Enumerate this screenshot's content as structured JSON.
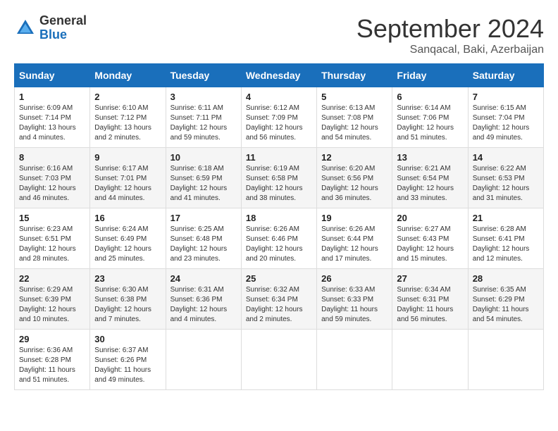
{
  "header": {
    "logo_general": "General",
    "logo_blue": "Blue",
    "month_title": "September 2024",
    "location": "Sanqacal, Baki, Azerbaijan"
  },
  "columns": [
    "Sunday",
    "Monday",
    "Tuesday",
    "Wednesday",
    "Thursday",
    "Friday",
    "Saturday"
  ],
  "weeks": [
    [
      {
        "day": "1",
        "sunrise": "Sunrise: 6:09 AM",
        "sunset": "Sunset: 7:14 PM",
        "daylight": "Daylight: 13 hours and 4 minutes."
      },
      {
        "day": "2",
        "sunrise": "Sunrise: 6:10 AM",
        "sunset": "Sunset: 7:12 PM",
        "daylight": "Daylight: 13 hours and 2 minutes."
      },
      {
        "day": "3",
        "sunrise": "Sunrise: 6:11 AM",
        "sunset": "Sunset: 7:11 PM",
        "daylight": "Daylight: 12 hours and 59 minutes."
      },
      {
        "day": "4",
        "sunrise": "Sunrise: 6:12 AM",
        "sunset": "Sunset: 7:09 PM",
        "daylight": "Daylight: 12 hours and 56 minutes."
      },
      {
        "day": "5",
        "sunrise": "Sunrise: 6:13 AM",
        "sunset": "Sunset: 7:08 PM",
        "daylight": "Daylight: 12 hours and 54 minutes."
      },
      {
        "day": "6",
        "sunrise": "Sunrise: 6:14 AM",
        "sunset": "Sunset: 7:06 PM",
        "daylight": "Daylight: 12 hours and 51 minutes."
      },
      {
        "day": "7",
        "sunrise": "Sunrise: 6:15 AM",
        "sunset": "Sunset: 7:04 PM",
        "daylight": "Daylight: 12 hours and 49 minutes."
      }
    ],
    [
      {
        "day": "8",
        "sunrise": "Sunrise: 6:16 AM",
        "sunset": "Sunset: 7:03 PM",
        "daylight": "Daylight: 12 hours and 46 minutes."
      },
      {
        "day": "9",
        "sunrise": "Sunrise: 6:17 AM",
        "sunset": "Sunset: 7:01 PM",
        "daylight": "Daylight: 12 hours and 44 minutes."
      },
      {
        "day": "10",
        "sunrise": "Sunrise: 6:18 AM",
        "sunset": "Sunset: 6:59 PM",
        "daylight": "Daylight: 12 hours and 41 minutes."
      },
      {
        "day": "11",
        "sunrise": "Sunrise: 6:19 AM",
        "sunset": "Sunset: 6:58 PM",
        "daylight": "Daylight: 12 hours and 38 minutes."
      },
      {
        "day": "12",
        "sunrise": "Sunrise: 6:20 AM",
        "sunset": "Sunset: 6:56 PM",
        "daylight": "Daylight: 12 hours and 36 minutes."
      },
      {
        "day": "13",
        "sunrise": "Sunrise: 6:21 AM",
        "sunset": "Sunset: 6:54 PM",
        "daylight": "Daylight: 12 hours and 33 minutes."
      },
      {
        "day": "14",
        "sunrise": "Sunrise: 6:22 AM",
        "sunset": "Sunset: 6:53 PM",
        "daylight": "Daylight: 12 hours and 31 minutes."
      }
    ],
    [
      {
        "day": "15",
        "sunrise": "Sunrise: 6:23 AM",
        "sunset": "Sunset: 6:51 PM",
        "daylight": "Daylight: 12 hours and 28 minutes."
      },
      {
        "day": "16",
        "sunrise": "Sunrise: 6:24 AM",
        "sunset": "Sunset: 6:49 PM",
        "daylight": "Daylight: 12 hours and 25 minutes."
      },
      {
        "day": "17",
        "sunrise": "Sunrise: 6:25 AM",
        "sunset": "Sunset: 6:48 PM",
        "daylight": "Daylight: 12 hours and 23 minutes."
      },
      {
        "day": "18",
        "sunrise": "Sunrise: 6:26 AM",
        "sunset": "Sunset: 6:46 PM",
        "daylight": "Daylight: 12 hours and 20 minutes."
      },
      {
        "day": "19",
        "sunrise": "Sunrise: 6:26 AM",
        "sunset": "Sunset: 6:44 PM",
        "daylight": "Daylight: 12 hours and 17 minutes."
      },
      {
        "day": "20",
        "sunrise": "Sunrise: 6:27 AM",
        "sunset": "Sunset: 6:43 PM",
        "daylight": "Daylight: 12 hours and 15 minutes."
      },
      {
        "day": "21",
        "sunrise": "Sunrise: 6:28 AM",
        "sunset": "Sunset: 6:41 PM",
        "daylight": "Daylight: 12 hours and 12 minutes."
      }
    ],
    [
      {
        "day": "22",
        "sunrise": "Sunrise: 6:29 AM",
        "sunset": "Sunset: 6:39 PM",
        "daylight": "Daylight: 12 hours and 10 minutes."
      },
      {
        "day": "23",
        "sunrise": "Sunrise: 6:30 AM",
        "sunset": "Sunset: 6:38 PM",
        "daylight": "Daylight: 12 hours and 7 minutes."
      },
      {
        "day": "24",
        "sunrise": "Sunrise: 6:31 AM",
        "sunset": "Sunset: 6:36 PM",
        "daylight": "Daylight: 12 hours and 4 minutes."
      },
      {
        "day": "25",
        "sunrise": "Sunrise: 6:32 AM",
        "sunset": "Sunset: 6:34 PM",
        "daylight": "Daylight: 12 hours and 2 minutes."
      },
      {
        "day": "26",
        "sunrise": "Sunrise: 6:33 AM",
        "sunset": "Sunset: 6:33 PM",
        "daylight": "Daylight: 11 hours and 59 minutes."
      },
      {
        "day": "27",
        "sunrise": "Sunrise: 6:34 AM",
        "sunset": "Sunset: 6:31 PM",
        "daylight": "Daylight: 11 hours and 56 minutes."
      },
      {
        "day": "28",
        "sunrise": "Sunrise: 6:35 AM",
        "sunset": "Sunset: 6:29 PM",
        "daylight": "Daylight: 11 hours and 54 minutes."
      }
    ],
    [
      {
        "day": "29",
        "sunrise": "Sunrise: 6:36 AM",
        "sunset": "Sunset: 6:28 PM",
        "daylight": "Daylight: 11 hours and 51 minutes."
      },
      {
        "day": "30",
        "sunrise": "Sunrise: 6:37 AM",
        "sunset": "Sunset: 6:26 PM",
        "daylight": "Daylight: 11 hours and 49 minutes."
      },
      null,
      null,
      null,
      null,
      null
    ]
  ]
}
